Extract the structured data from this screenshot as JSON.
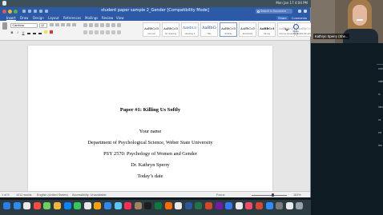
{
  "menubar": {
    "status_text": "Mon Jan 17 4:04 PM"
  },
  "window": {
    "title": "student paper sample 2_Gender [Compatibility Mode]",
    "search_placeholder": "Search in Document"
  },
  "ribbon_tabs": [
    {
      "label": "Insert"
    },
    {
      "label": "Draw"
    },
    {
      "label": "Design"
    },
    {
      "label": "Layout"
    },
    {
      "label": "References"
    },
    {
      "label": "Mailings"
    },
    {
      "label": "Review"
    },
    {
      "label": "View"
    }
  ],
  "ribbon_right": {
    "share_label": "Share",
    "comments_label": "Comments"
  },
  "ribbon": {
    "font_name": "Cambria",
    "font_size": "12",
    "format_buttons": [
      "B",
      "I",
      "U"
    ],
    "styles": [
      {
        "sample": "AaBbCcDdEe",
        "name": "Normal"
      },
      {
        "sample": "AaBbCcDdEe",
        "name": "No Spacing"
      },
      {
        "sample": "AaBbCcDc",
        "name": "Heading 1"
      },
      {
        "sample": "AaBbCcD",
        "name": "Title"
      },
      {
        "sample": "AaBbCcDdEe",
        "name": "Subtitle"
      },
      {
        "sample": "AaBbCcDdEe",
        "name": "Emphasis"
      },
      {
        "sample": "AaBbCcDdEe",
        "name": "Strong"
      },
      {
        "sample": "AaBbCcDdEe",
        "name": "Intense Quote"
      },
      {
        "sample": "AaBbCcDdEe",
        "name": "Subtle Empha..."
      }
    ],
    "styles_pane_label": "Styles Pane"
  },
  "document": {
    "title": "Paper #1: Killing Us Softly",
    "lines": [
      "Your name",
      "Department of Psychological Science, Weber State University",
      "PSY 2570: Psychology of Women and Gender",
      "Dr. Kathryn Sperry",
      "Today’s date"
    ]
  },
  "statusbar": {
    "page_info": "1 of 5",
    "word_count": "1011 words",
    "language": "English (United States)",
    "accessibility": "Accessibility: Unavailable",
    "focus_label": "Focus",
    "zoom_label": "183%",
    "zoom_level": 0.6
  },
  "sidebar_labels": [
    "zoom",
    "ntations",
    "rs",
    "ideos",
    "ns",
    "ext",
    "iew"
  ],
  "video": {
    "participant_name": "Kathryn Sperry (She..."
  },
  "dock": {
    "icon_colors": [
      "#2b7de9",
      "#2c8df0",
      "#e9e9e9",
      "#ff4b3e",
      "#6fcf5b",
      "#f6b53a",
      "#0a84ff",
      "#34c759",
      "#e8e8e8",
      "#ff9f0a",
      "#2d89ef",
      "#5ac8fa",
      "#ff2d55",
      "#a2845e",
      "#1d1d1f",
      "#0b7a3e",
      "#ff6b00",
      "#e9e9e9",
      "#2b579a",
      "#217346",
      "#d24726",
      "#7719aa",
      "#3478f6",
      "#e9e9e9",
      "#f24b6a",
      "#d94530",
      "#2d8cff",
      "#7a7a7a",
      "#e9e9e9",
      "#9aa3aa"
    ]
  }
}
